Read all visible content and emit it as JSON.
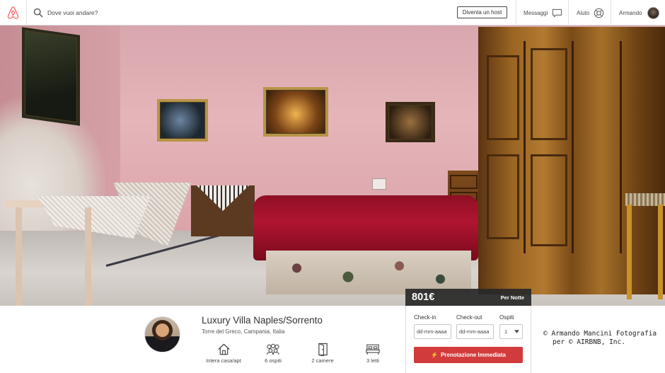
{
  "nav": {
    "search_placeholder": "Dove vuoi andare?",
    "become_host": "Diventa un host",
    "messages": "Messaggi",
    "help": "Aiuto",
    "user_name": "Armando"
  },
  "price": {
    "amount": "801€",
    "unit": "Per Notte"
  },
  "listing": {
    "title": "Luxury Villa Naples/Sorrento",
    "location": "Torre del Greco, Campania, Italia",
    "amenities": [
      {
        "icon": "home-icon",
        "label": "Intera casa/apt"
      },
      {
        "icon": "guests-icon",
        "label": "6 ospiti"
      },
      {
        "icon": "door-icon",
        "label": "2 camere"
      },
      {
        "icon": "bed-icon",
        "label": "3 letti"
      }
    ]
  },
  "booking": {
    "checkin_label": "Check-in",
    "checkout_label": "Check-out",
    "guests_label": "Ospiti",
    "checkin_placeholder": "dd-mm-aaaa",
    "checkout_placeholder": "dd-mm-aaaa",
    "guests_value": "1",
    "book_button": "Prenotazione Immediata"
  },
  "watermark": {
    "line1": "© Armando Mancini Fotografia",
    "line2": "per © AIRBNB, Inc."
  },
  "colors": {
    "brand": "#ff5a5f",
    "book_button": "#d23b3b",
    "price_bar": "#282828"
  }
}
